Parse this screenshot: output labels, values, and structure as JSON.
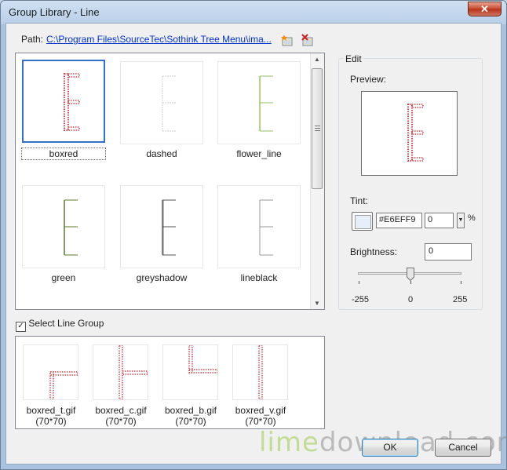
{
  "window": {
    "title": "Group Library - Line",
    "close_glyph": "✕"
  },
  "path": {
    "label": "Path:",
    "value": "C:\\Program Files\\SourceTec\\Sothink Tree Menu\\ima..."
  },
  "toolbar": {
    "add_icon": "add-folder-icon",
    "delete_icon": "delete-folder-icon"
  },
  "gallery": {
    "items": [
      {
        "label": "boxred"
      },
      {
        "label": "dashed"
      },
      {
        "label": "flower_line"
      },
      {
        "label": "green"
      },
      {
        "label": "greyshadow"
      },
      {
        "label": "lineblack"
      }
    ],
    "selected": "boxred"
  },
  "select_line_group": {
    "label": "Select Line Group",
    "checked": true
  },
  "group_items": [
    {
      "name": "boxred_t.gif",
      "size": "(70*70)"
    },
    {
      "name": "boxred_c.gif",
      "size": "(70*70)"
    },
    {
      "name": "boxred_b.gif",
      "size": "(70*70)"
    },
    {
      "name": "boxred_v.gif",
      "size": "(70*70)"
    }
  ],
  "edit": {
    "legend": "Edit",
    "preview_label": "Preview:",
    "tint_label": "Tint:",
    "tint_hex": "#E6EFF9",
    "tint_amount": "0",
    "tint_unit": "%",
    "brightness_label": "Brightness:",
    "brightness_value": "0",
    "scale_min": "-255",
    "scale_mid": "0",
    "scale_max": "255"
  },
  "buttons": {
    "ok": "OK",
    "cancel": "Cancel"
  },
  "watermark": {
    "lime": "lime",
    "download": "download.com"
  },
  "colors": {
    "accent_red": "#d8454f",
    "selection_blue": "#3170c6",
    "link": "#0033cc",
    "tint_swatch": "#E6EFF9"
  }
}
